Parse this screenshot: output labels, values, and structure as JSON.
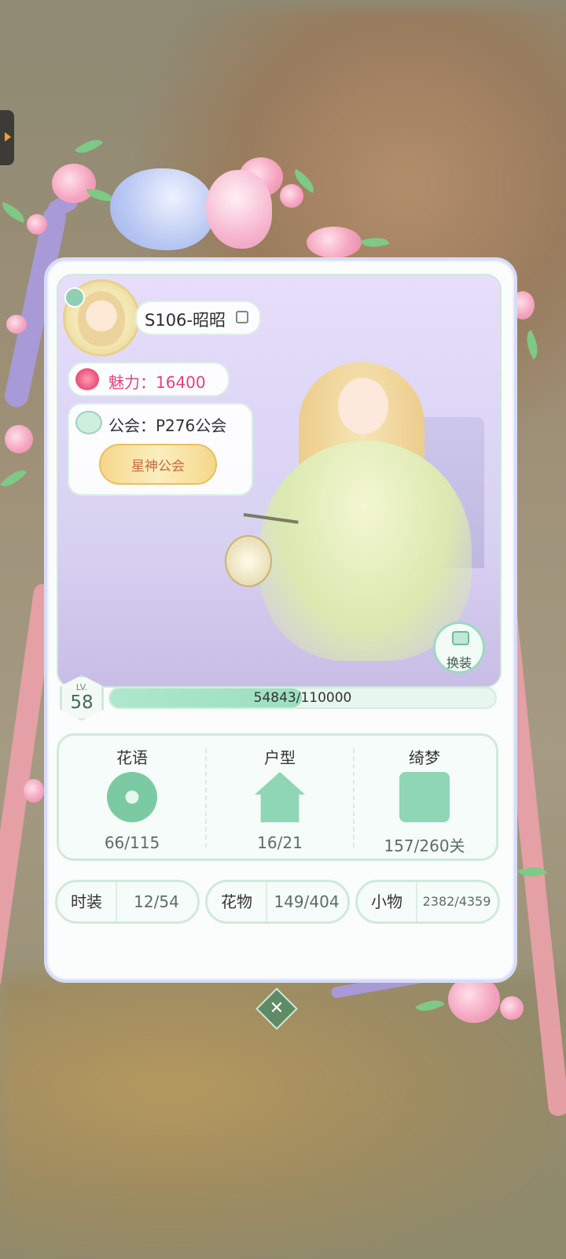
{
  "profile": {
    "name": "S106-昭昭",
    "charm": "魅力：16400",
    "guild": "公会：P276公会",
    "guild_badge": "星神公会",
    "dress_button": "换装"
  },
  "level": {
    "label": "LV.",
    "value": "58",
    "xp_text": "54843/110000",
    "xp_fraction": 0.4986
  },
  "stats": [
    {
      "title": "花语",
      "value": "66/115",
      "icon": "flower-icon"
    },
    {
      "title": "户型",
      "value": "16/21",
      "icon": "house-icon"
    },
    {
      "title": "绮梦",
      "value": "157/260关",
      "icon": "letter-feather-icon"
    }
  ],
  "collections": [
    {
      "label": "时装",
      "value": "12/54"
    },
    {
      "label": "花物",
      "value": "149/404"
    },
    {
      "label": "小物",
      "value": "2382/4359"
    }
  ],
  "colors": {
    "accent": "#8fd6b4",
    "charm": "#e0467a",
    "panel_border": "#d7dcf6"
  }
}
